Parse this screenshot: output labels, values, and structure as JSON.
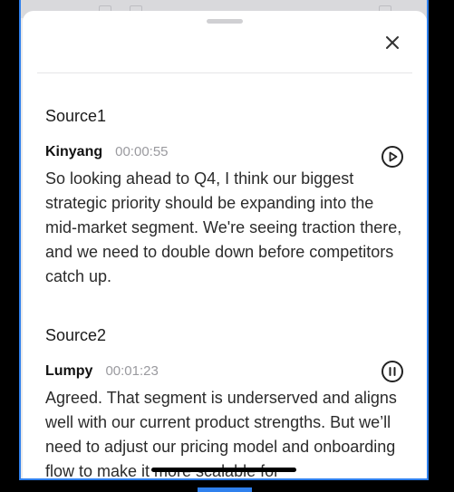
{
  "sheet": {
    "close_icon": "close-icon"
  },
  "sources": [
    {
      "title": "Source1",
      "speaker": "Kinyang",
      "timestamp": "00:00:55",
      "control_icon": "play-icon",
      "text": "So looking ahead to Q4, I think our biggest strategic priority should be expanding into the mid-market segment. We're seeing traction there, and we need to double down before competitors catch up."
    },
    {
      "title": "Source2",
      "speaker": "Lumpy",
      "timestamp": "00:01:23",
      "control_icon": "pause-icon",
      "text": "Agreed. That segment is underserved and aligns well with our current product strengths. But we’ll need to adjust our pricing model and onboarding flow to make it more scalable for"
    }
  ],
  "colors": {
    "accent": "#2f80ed",
    "text": "#2b2b2b",
    "timestamp": "#9a9a9f"
  }
}
